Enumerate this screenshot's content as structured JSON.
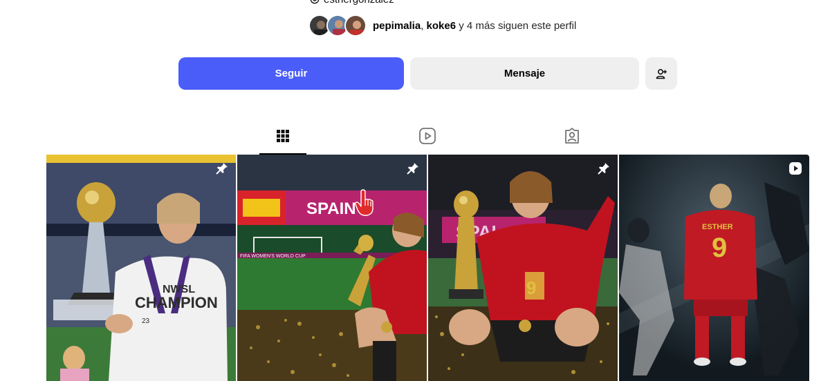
{
  "profile": {
    "handle": "esthergonzalez",
    "followed_by": {
      "user1": "pepimalia",
      "separator": ",",
      "user2": "koke6",
      "rest": "y 4 más siguen este perfil"
    }
  },
  "actions": {
    "follow_label": "Seguir",
    "message_label": "Mensaje",
    "suggest_icon": "person-plus-icon"
  },
  "tabs": [
    {
      "icon": "grid-icon",
      "active": true
    },
    {
      "icon": "reels-icon",
      "active": false
    },
    {
      "icon": "tagged-icon",
      "active": false
    }
  ],
  "posts": [
    {
      "badge": "pin-icon",
      "caption_text": [
        "NWSL",
        "CHAMPION",
        "23"
      ]
    },
    {
      "badge": "pin-icon",
      "caption_text": [
        "SPAIN",
        "FIFA WOMEN'S WORLD CUP"
      ]
    },
    {
      "badge": "pin-icon",
      "caption_text": [
        "SPAI",
        "9"
      ]
    },
    {
      "badge": "reel-icon",
      "caption_text": [
        "ESTHER",
        "9"
      ]
    }
  ],
  "colors": {
    "follow_button": "#4a5df9",
    "secondary_button": "#efefef",
    "spain_red": "#c8102e"
  }
}
